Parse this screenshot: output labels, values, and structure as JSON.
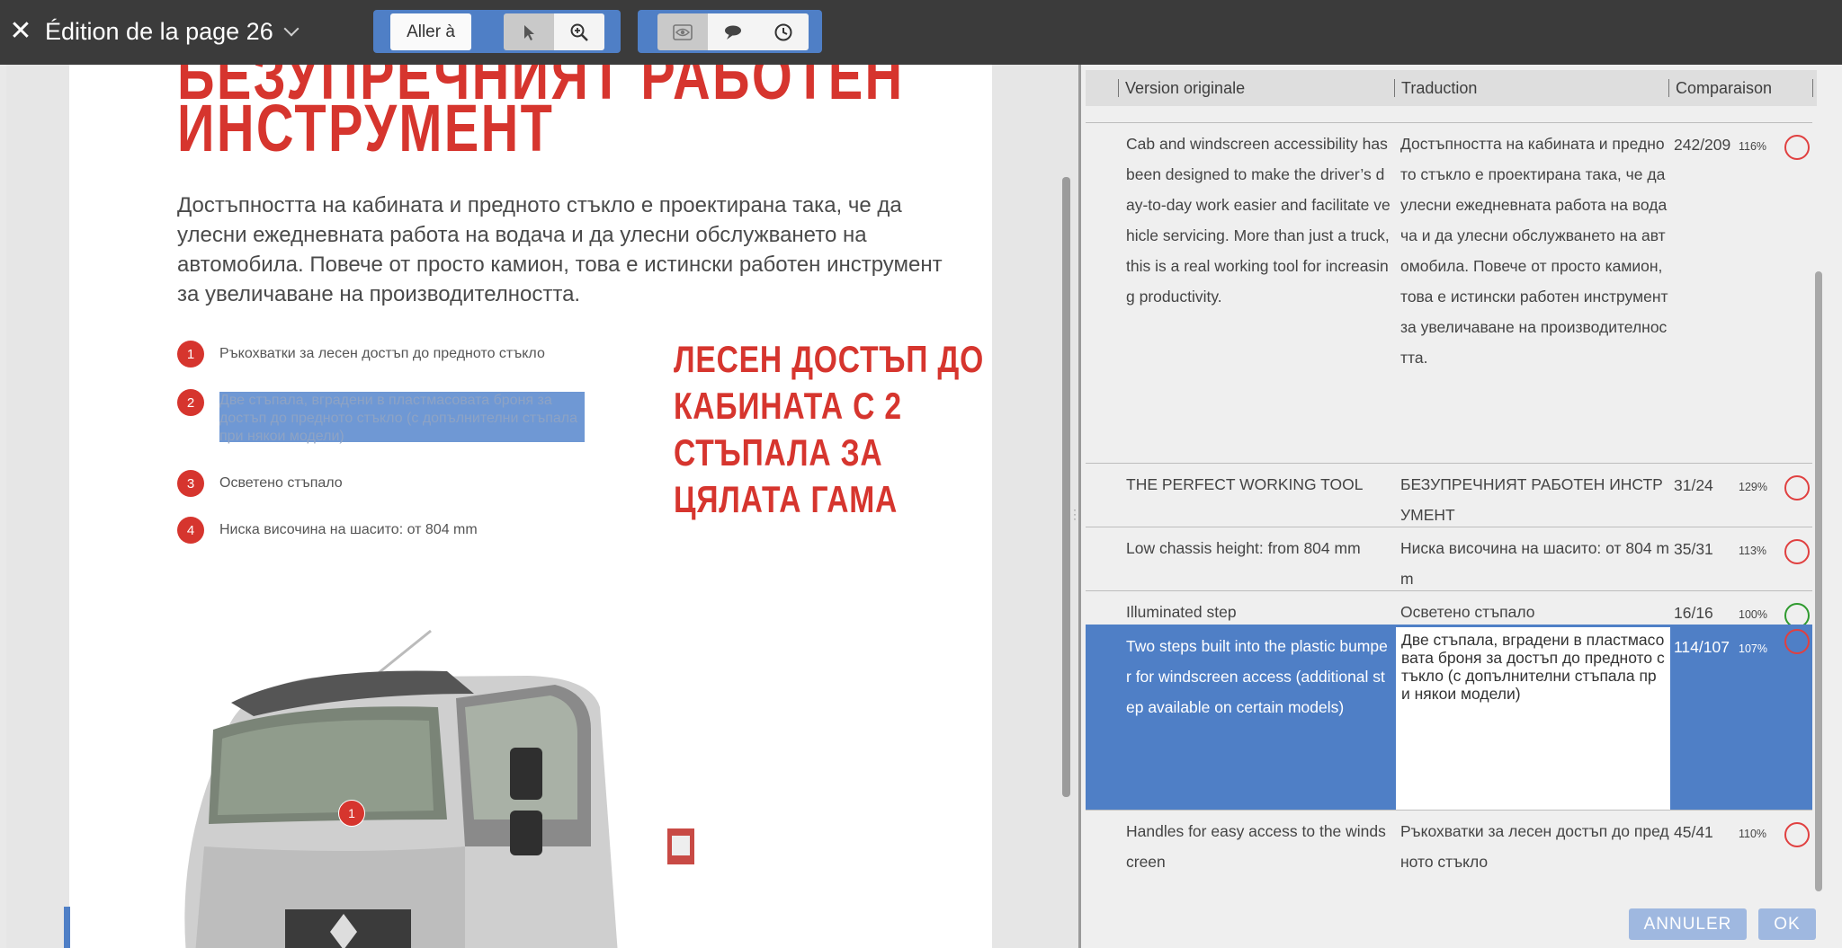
{
  "topbar": {
    "close_glyph": "✕",
    "title": "Édition de la page 26",
    "goto_label": "Aller à",
    "icons": [
      "pointer-icon",
      "zoom-in-icon",
      "eye-icon",
      "comment-icon",
      "history-icon"
    ]
  },
  "page": {
    "heading_top": "БЕЗУПРЕЧНИЯТ РАБОТЕН",
    "heading_main": "ИНСТРУМЕНТ",
    "intro": "Достъпността на кабината и предното стъкло е проектирана така, че да улесни ежедневната работа на водача и да улесни обслужването на автомобила. Повече от просто камион, това е истински работен инструмент за увеличаване на производителността.",
    "features": [
      {
        "num": "1",
        "text": "Ръкохватки за лесен достъп до предното стъкло"
      },
      {
        "num": "2",
        "text": "Две стъпала, вградени в пластмасовата броня за достъп до предното стъкло (с допълнителни стъпала при някои модели)"
      },
      {
        "num": "3",
        "text": "Осветено стъпало"
      },
      {
        "num": "4",
        "text": "Ниска височина на шасито: от 804 mm"
      }
    ],
    "callout": [
      "ЛЕСЕН ДОСТЪП ДО",
      "КАБИНАТА С 2",
      "СТЪПАЛА ЗА",
      "ЦЯЛАТА ГАМА"
    ],
    "truck_marker": "1"
  },
  "table": {
    "headers": {
      "original": "Version originale",
      "translation": "Traduction",
      "comparison": "Comparaison"
    },
    "rows": [
      {
        "original": "Cab and windscreen accessibility has been designed to make the driver’s day-to-day work easier and facilitate vehicle servicing. More than just a truck, this is a real working tool for increasing productivity.",
        "translation": "Достъпността на кабината и предното стъкло е проектирана така, че да улесни ежедневната работа на водача и да улесни обслужването на автомобила. Повече от просто камион, това е истински работен инструмент за увеличаване на производителността.",
        "count": "242/209",
        "pct": "116%",
        "status": "warning",
        "status_color": "#e04040"
      },
      {
        "original": "THE PERFECT WORKING TOOL",
        "translation": "БЕЗУПРЕЧНИЯТ РАБОТЕН ИНСТРУМЕНТ",
        "count": "31/24",
        "pct": "129%",
        "status": "warning",
        "status_color": "#e04040"
      },
      {
        "original": "Low chassis height: from 804 mm",
        "translation": "Ниска височина на шасито: от 804 mm",
        "count": "35/31",
        "pct": "113%",
        "status": "warning",
        "status_color": "#e04040"
      },
      {
        "original": "Illuminated step",
        "translation": "Осветено стъпало",
        "count": "16/16",
        "pct": "100%",
        "status": "ok",
        "status_color": "#2e9a2e"
      },
      {
        "original": "Two steps built into the plastic bumper for windscreen access (additional step available on certain models)",
        "translation": "Две стъпала, вградени в пластмасовата броня за достъп до предното стъкло (с допълнителни стъпала при някои модели)",
        "count": "114/107",
        "pct": "107%",
        "status": "warning",
        "status_color": "#e04040",
        "selected": true
      },
      {
        "original": "Handles for easy access to the windscreen",
        "translation": "Ръкохватки за лесен достъп до предното стъкло",
        "count": "45/41",
        "pct": "110%",
        "status": "warning",
        "status_color": "#e04040"
      }
    ]
  },
  "footer": {
    "cancel_label": "ANNULER",
    "ok_label": "OK"
  },
  "colors": {
    "accent": "#4f7fc6",
    "brand_red": "#d6352e",
    "topbar": "#3b3b3b"
  }
}
